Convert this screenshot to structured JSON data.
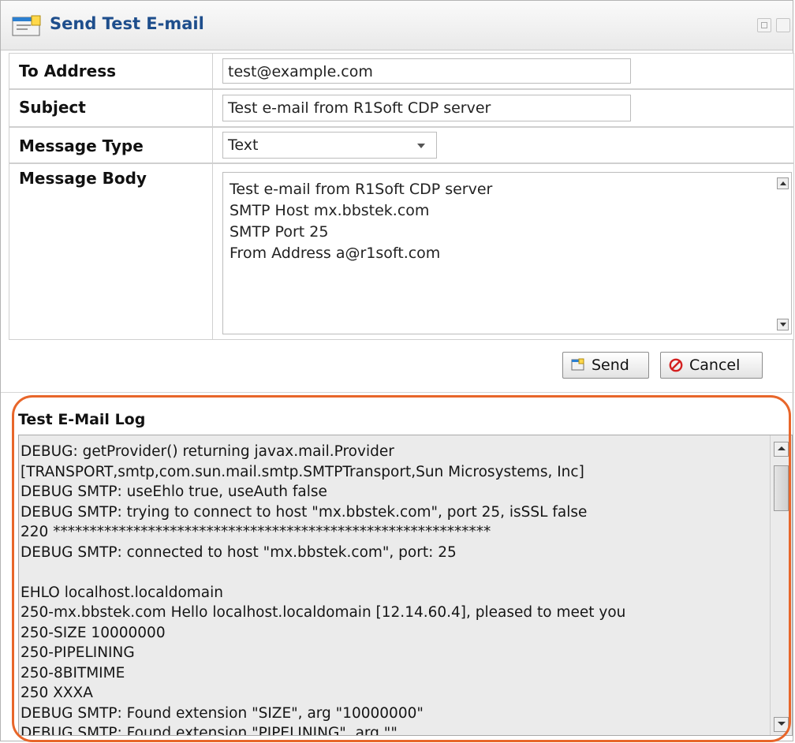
{
  "window": {
    "title": "Send Test E-mail"
  },
  "form": {
    "to_label": "To Address",
    "to_value": "test@example.com",
    "subject_label": "Subject",
    "subject_value": "Test e-mail from R1Soft CDP server",
    "type_label": "Message Type",
    "type_value": "Text",
    "body_label": "Message Body",
    "body_lines": [
      "Test e-mail from R1Soft CDP server",
      "SMTP Host mx.bbstek.com",
      "SMTP Port 25",
      "From Address a@r1soft.com"
    ]
  },
  "buttons": {
    "send_label": "Send",
    "cancel_label": "Cancel"
  },
  "log": {
    "title": "Test E-Mail Log",
    "lines": [
      "DEBUG: getProvider() returning javax.mail.Provider",
      "[TRANSPORT,smtp,com.sun.mail.smtp.SMTPTransport,Sun Microsystems, Inc]",
      "DEBUG SMTP: useEhlo true, useAuth false",
      "DEBUG SMTP: trying to connect to host \"mx.bbstek.com\", port 25, isSSL false",
      "220 ************************************************************",
      "DEBUG SMTP: connected to host \"mx.bbstek.com\", port: 25",
      "",
      "EHLO localhost.localdomain",
      "250-mx.bbstek.com Hello localhost.localdomain [12.14.60.4], pleased to meet you",
      "250-SIZE 10000000",
      "250-PIPELINING",
      "250-8BITMIME",
      "250 XXXA",
      "DEBUG SMTP: Found extension \"SIZE\", arg \"10000000\"",
      "DEBUG SMTP: Found extension \"PIPELINING\", arg \"\""
    ]
  },
  "colors": {
    "title": "#1e4e8c",
    "highlight": "#e8662a",
    "cancel_icon": "#d42020",
    "log_bg": "#ebebeb"
  }
}
